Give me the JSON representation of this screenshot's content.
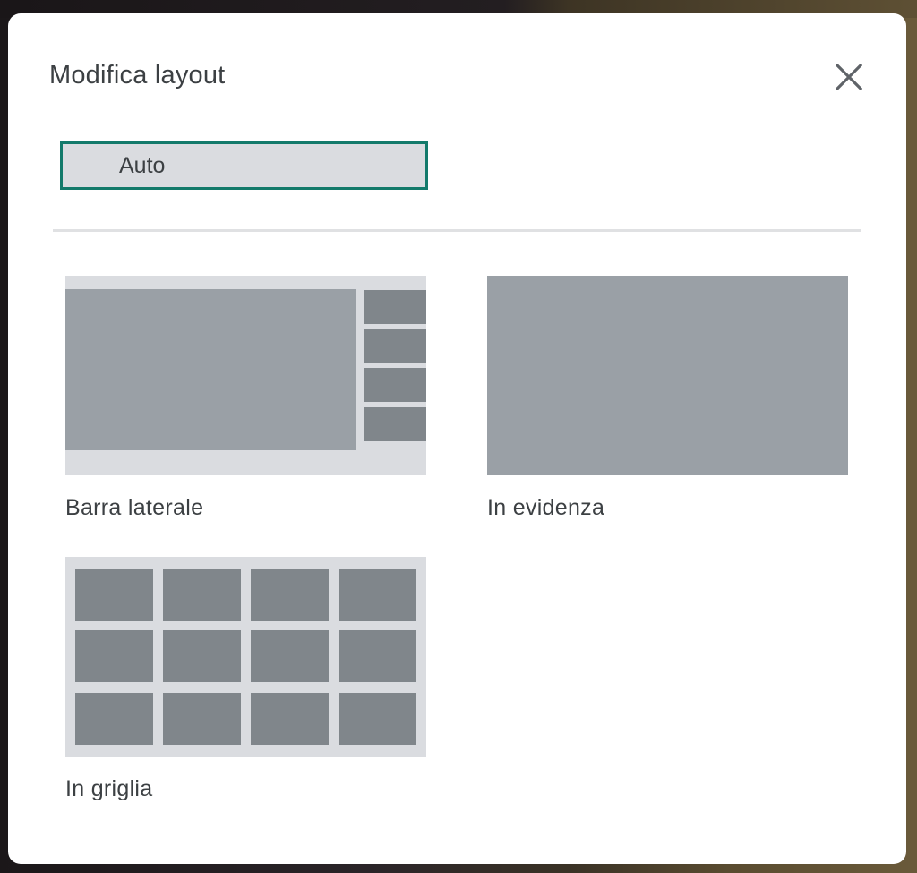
{
  "dialog": {
    "title": "Modifica layout",
    "close_icon": "close-icon"
  },
  "auto": {
    "label": "Auto",
    "selected": true
  },
  "layouts": [
    {
      "id": "sidebar",
      "label": "Barra laterale"
    },
    {
      "id": "spotlight",
      "label": "In evidenza"
    },
    {
      "id": "grid",
      "label": "In griglia"
    }
  ],
  "colors": {
    "selected_border": "#137a6b",
    "option_bg": "#dadce0",
    "main_tile": "#9aa0a6",
    "small_tile": "#80868b",
    "text": "#3c4043"
  }
}
